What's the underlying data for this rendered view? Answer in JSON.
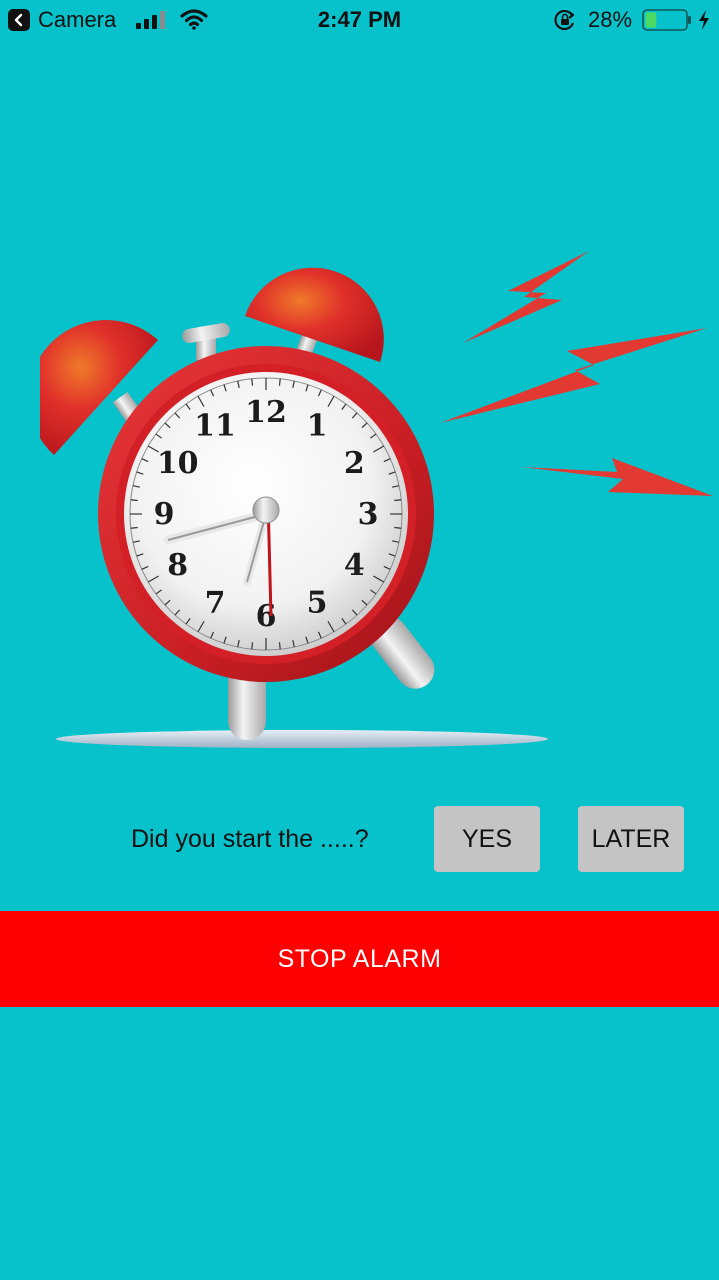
{
  "status_bar": {
    "back_app_label": "Camera",
    "time": "2:47 PM",
    "battery_percent": "28%",
    "battery_level": 0.28,
    "back_icon": "chevron-left-icon",
    "signal_icon": "cellular-signal-icon",
    "wifi_icon": "wifi-icon",
    "lock_icon": "rotation-lock-icon",
    "battery_icon": "battery-icon",
    "charging_icon": "charging-bolt-icon"
  },
  "illustration": {
    "type": "alarm-clock-icon",
    "clock_numbers": [
      "12",
      "1",
      "2",
      "3",
      "4",
      "5",
      "6",
      "7",
      "8",
      "9",
      "10",
      "11"
    ]
  },
  "prompt": {
    "question": "Did you start the .....?",
    "yes_label": "YES",
    "later_label": "LATER"
  },
  "stop_alarm": {
    "label": "STOP ALARM"
  },
  "colors": {
    "background": "#08c2cb",
    "stop_bar": "#ff0000",
    "button_grey": "#c4c4c4",
    "clock_red": "#d32027",
    "bolt_red": "#e23a32",
    "battery_green": "#4cd964"
  }
}
